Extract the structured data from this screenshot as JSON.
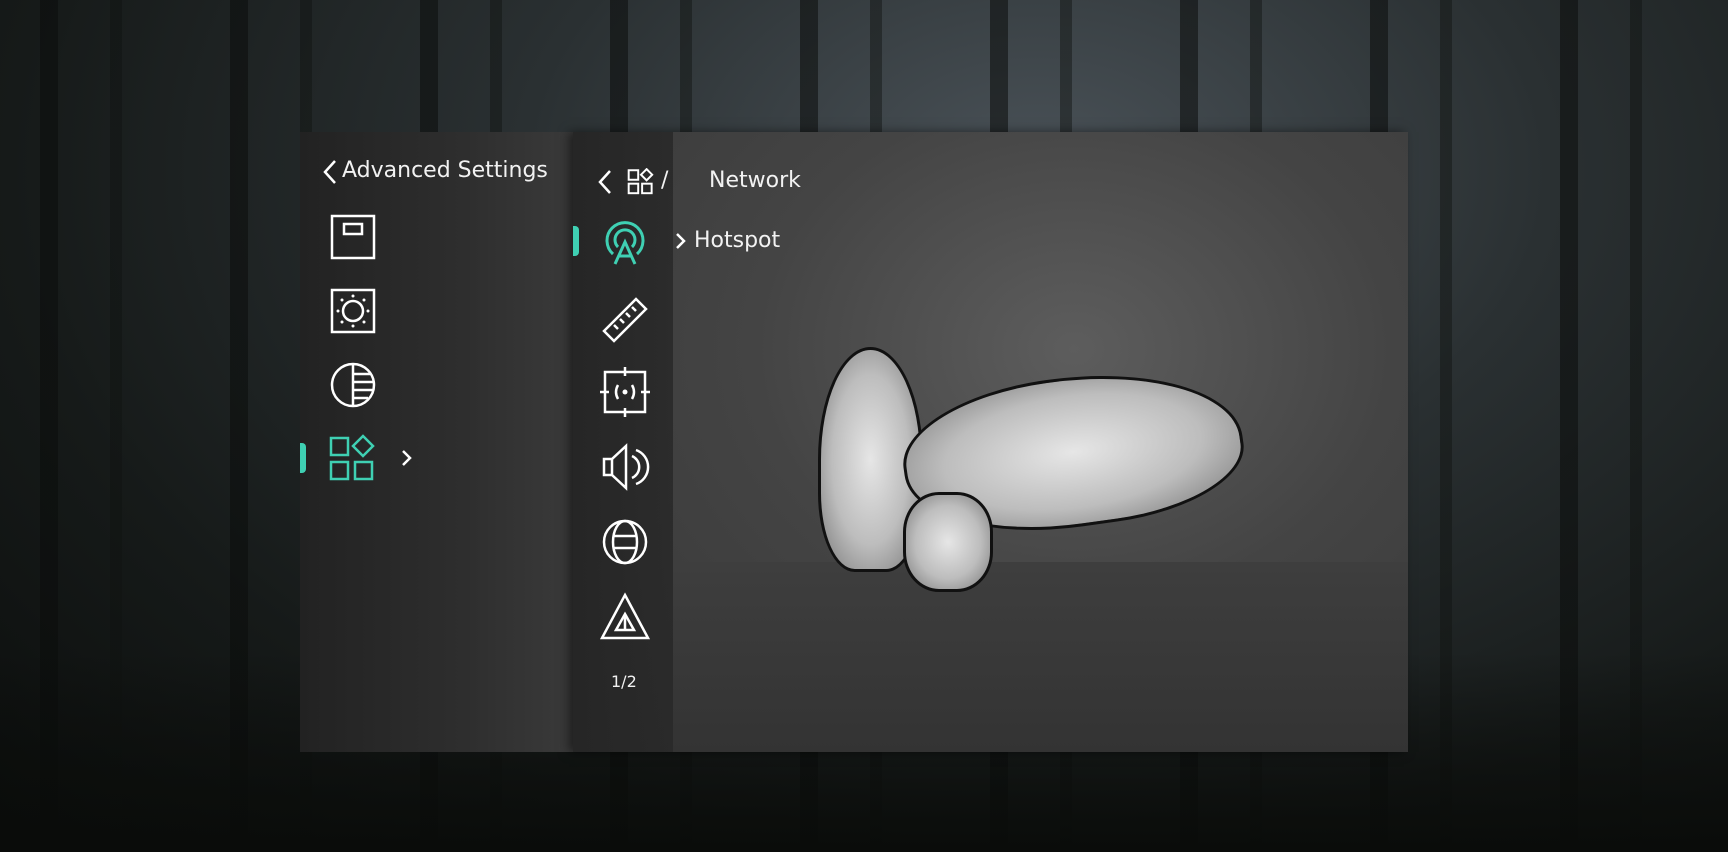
{
  "accent_color": "#3fd0b3",
  "left_panel": {
    "title": "Advanced Settings",
    "items": [
      {
        "icon": "display-frame-icon"
      },
      {
        "icon": "brightness-icon"
      },
      {
        "icon": "contrast-icon"
      },
      {
        "icon": "more-functions-icon",
        "selected": true,
        "chevron": "›"
      }
    ]
  },
  "right_panel": {
    "breadcrumb_separator": "/",
    "title": "Network",
    "items": [
      {
        "icon": "hotspot-icon",
        "selected": true,
        "label": "Hotspot"
      },
      {
        "icon": "ruler-icon"
      },
      {
        "icon": "calibration-icon"
      },
      {
        "icon": "speaker-icon"
      },
      {
        "icon": "globe-icon"
      },
      {
        "icon": "warning-icon"
      }
    ],
    "page_indicator": "1/2"
  }
}
